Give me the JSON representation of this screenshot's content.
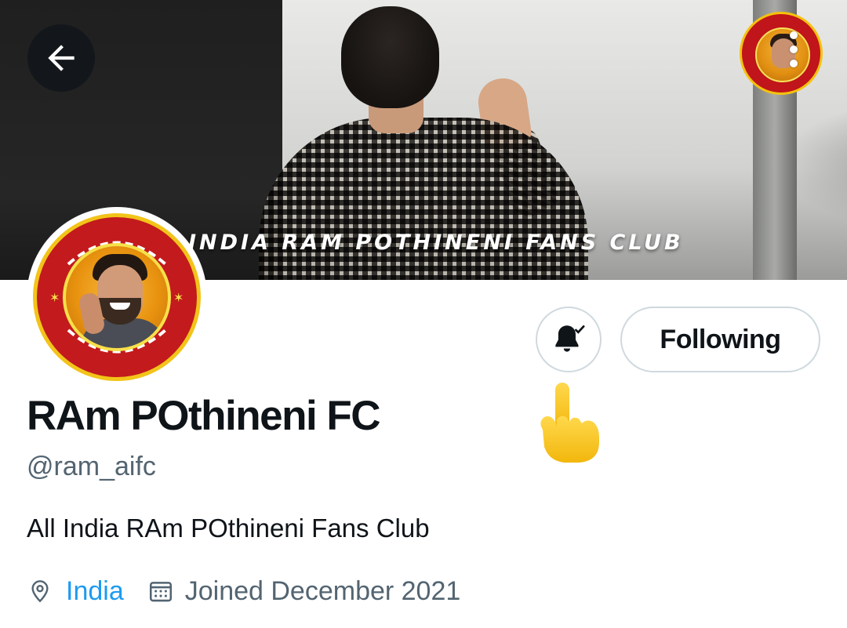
{
  "banner": {
    "caption": "INDIA RAM POTHINENI FANS CLUB"
  },
  "header": {
    "back_icon": "arrow-left-icon",
    "more_icon": "more-vertical-icon"
  },
  "actions": {
    "notify_icon": "bell-check-icon",
    "following_label": "Following"
  },
  "profile": {
    "display_name": "RAm POthineni FC",
    "handle": "@ram_aifc",
    "bio": "All India RAm POthineni Fans Club",
    "location": "India",
    "joined": "Joined December 2021",
    "location_icon": "map-pin-icon",
    "calendar_icon": "calendar-icon"
  },
  "colors": {
    "link": "#1d9bf0",
    "secondary_text": "#536471",
    "primary_text": "#0f1419",
    "border": "#cfd9de",
    "seal_red": "#c31a1d",
    "seal_gold": "#f2c419"
  }
}
